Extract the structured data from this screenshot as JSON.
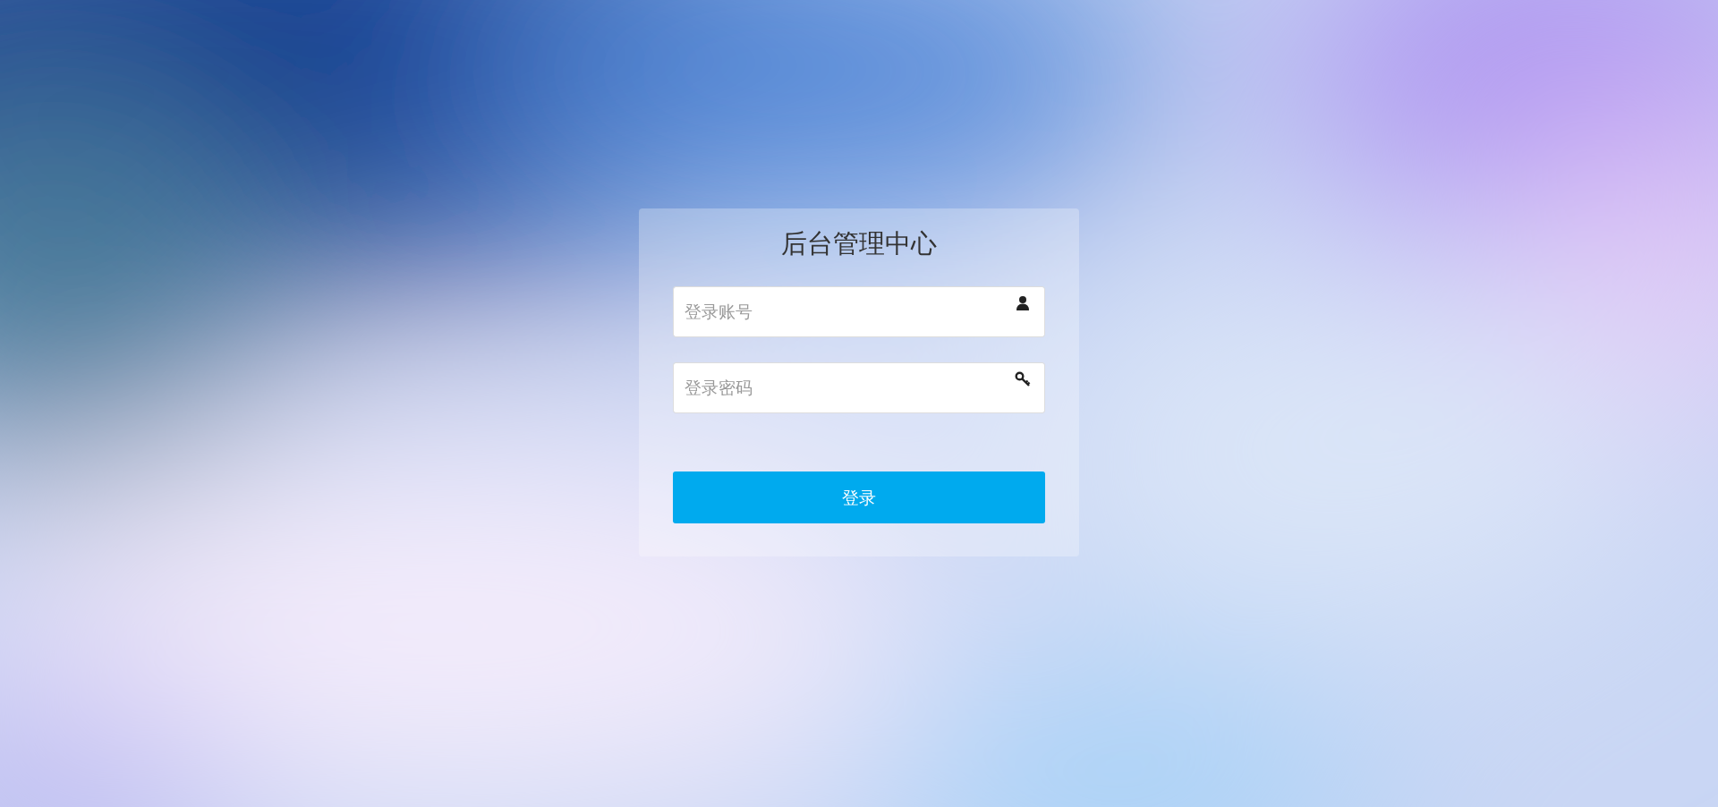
{
  "title": "后台管理中心",
  "fields": [
    {
      "kind": "account",
      "placeholder": "登录账号"
    },
    {
      "kind": "password",
      "placeholder": "登录密码"
    }
  ],
  "button": {
    "label": "登录"
  }
}
